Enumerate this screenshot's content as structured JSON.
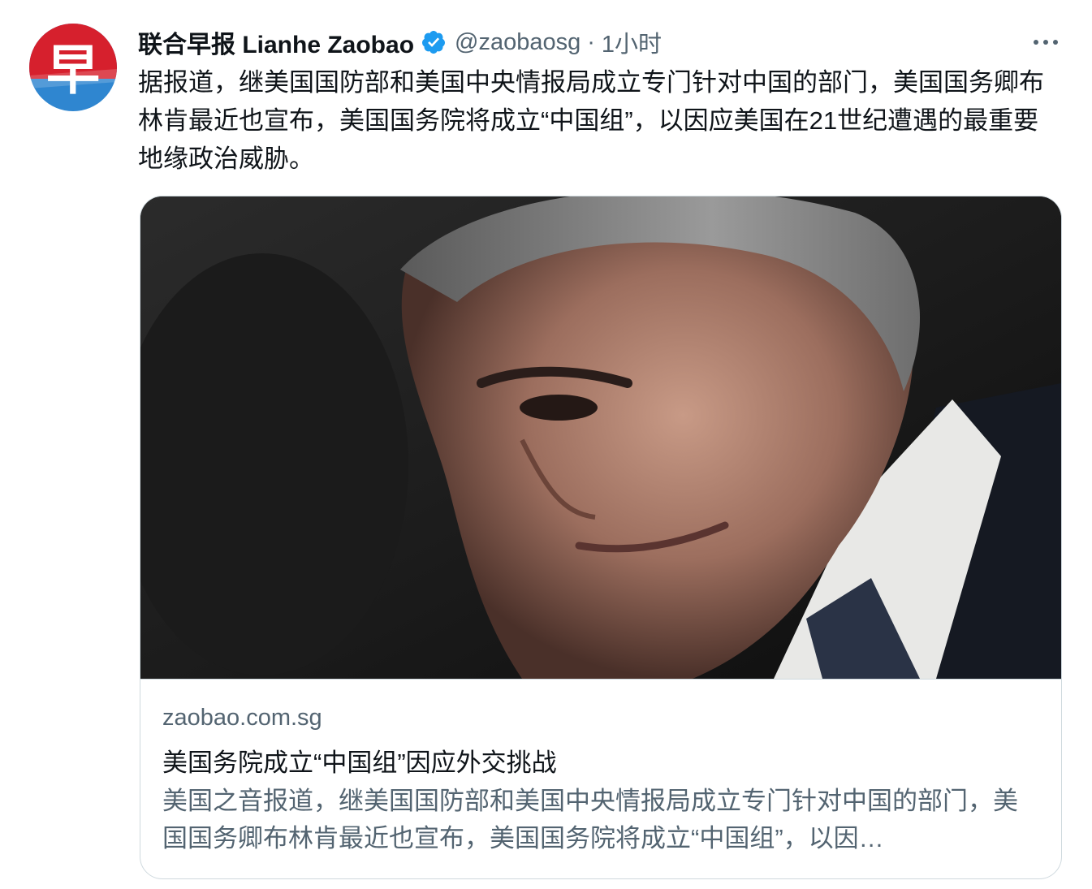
{
  "tweet": {
    "display_name": "联合早报 Lianhe Zaobao",
    "handle": "@zaobaosg",
    "separator": "·",
    "time": "1小时",
    "text": "据报道，继美国国防部和美国中央情报局成立专门针对中国的部门，美国国务卿布林肯最近也宣布，美国国务院将成立“中国组”，以因应美国在21世纪遭遇的最重要地缘政治威胁。",
    "avatar_glyph": "早"
  },
  "card": {
    "domain": "zaobao.com.sg",
    "title": "美国务院成立“中国组”因应外交挑战",
    "description": "美国之音报道，继美国国防部和美国中央情报局成立专门针对中国的部门，美国国务卿布林肯最近也宣布，美国国务院将成立“中国组”，以因…"
  },
  "colors": {
    "avatar_red": "#d6202d",
    "avatar_blue": "#2f86d0",
    "verified_blue": "#1d9bf0",
    "secondary_text": "#536471",
    "border": "#cfd9de"
  },
  "icons": {
    "verified": "verified-badge-icon",
    "more": "more-dots-icon"
  }
}
